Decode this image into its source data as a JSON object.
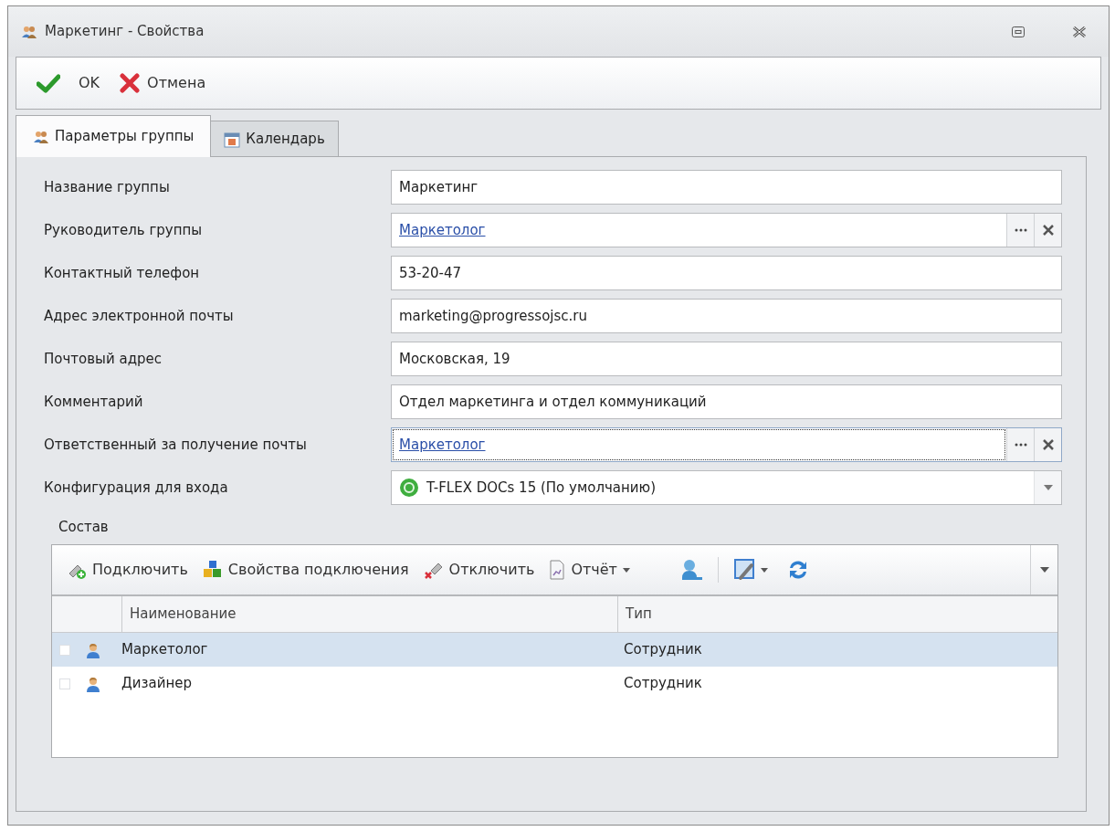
{
  "window": {
    "title": "Маркетинг - Свойства"
  },
  "toolbar": [
    {
      "kind": "ok",
      "label": "OK"
    },
    {
      "kind": "cancel",
      "label": "Отмена"
    }
  ],
  "tabs": [
    {
      "label": "Параметры группы",
      "kind": "group",
      "selected": true
    },
    {
      "label": "Календарь",
      "kind": "calendar",
      "selected": false
    }
  ],
  "fields": [
    {
      "label": "Название группы",
      "kind": "text",
      "value": "Маркетинг",
      "focused": false
    },
    {
      "label": "Руководитель группы",
      "kind": "link",
      "value": "Маркетолог",
      "focused": false
    },
    {
      "label": "Контактный телефон",
      "kind": "text",
      "value": "53-20-47",
      "focused": false
    },
    {
      "label": "Адрес электронной почты",
      "kind": "text",
      "value": "marketing@progressojsc.ru",
      "focused": false
    },
    {
      "label": "Почтовый адрес",
      "kind": "text",
      "value": "Московская, 19",
      "focused": false
    },
    {
      "label": "Комментарий",
      "kind": "text",
      "value": "Отдел маркетинга и отдел коммуникаций",
      "focused": false
    },
    {
      "label": "Ответственный за получение почты",
      "kind": "link",
      "value": "Маркетолог",
      "focused": true
    },
    {
      "label": "Конфигурация для входа",
      "kind": "combo",
      "value": "T-FLEX DOCs 15 (По умолчанию)",
      "focused": false
    }
  ],
  "members": {
    "title": "Состав",
    "toolbar": [
      {
        "kind": "connect",
        "label": "Подключить"
      },
      {
        "kind": "properties",
        "label": "Свойства подключения"
      },
      {
        "kind": "disconnect",
        "label": "Отключить"
      },
      {
        "kind": "report",
        "label": "Отчёт"
      }
    ],
    "columns": [
      "Наименование",
      "Тип"
    ],
    "rows": [
      {
        "name": "Маркетолог",
        "type": "Сотрудник",
        "selected": true
      },
      {
        "name": "Дизайнер",
        "type": "Сотрудник",
        "selected": false
      }
    ]
  }
}
